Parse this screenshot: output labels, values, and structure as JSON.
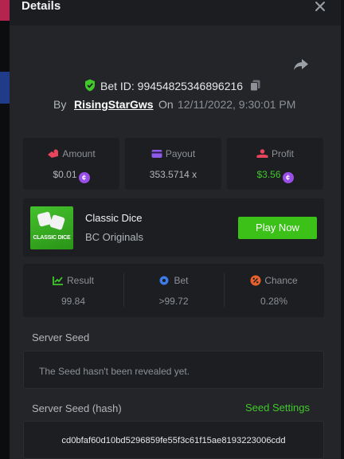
{
  "header": {
    "title": "Details"
  },
  "bet": {
    "id_text": "Bet ID: 99454825346896216",
    "by_label": "By",
    "user": "RisingStarGws",
    "on_label": "On",
    "datetime": "12/11/2022, 9:30:01 PM"
  },
  "stats": {
    "amount": {
      "label": "Amount",
      "value": "$0.01"
    },
    "payout": {
      "label": "Payout",
      "value": "353.5714 x"
    },
    "profit": {
      "label": "Profit",
      "value": "$3.56"
    }
  },
  "game": {
    "thumb_caption": "CLASSIC DICE",
    "name": "Classic Dice",
    "provider": "BC Originals",
    "play_label": "Play Now"
  },
  "result": {
    "result": {
      "label": "Result",
      "value": "99.84"
    },
    "bet": {
      "label": "Bet",
      "value": ">99.72"
    },
    "chance": {
      "label": "Chance",
      "value": "0.28%"
    }
  },
  "seeds": {
    "server_seed_label": "Server Seed",
    "server_seed_value": "The Seed hasn't been revealed yet.",
    "server_seed_hash_label": "Server Seed (hash)",
    "seed_settings_label": "Seed Settings",
    "server_seed_hash_value": "cd0bfaf60d10bd5296859fe55f3c61f15ae8193223006cdd"
  },
  "colors": {
    "accent_green": "#3bc117",
    "coin_purple": "#9a4ee8",
    "panel": "#1c1e21",
    "modal": "#232528"
  },
  "icons": [
    "close-icon",
    "share-icon",
    "shield-check-icon",
    "copy-icon",
    "amount-icon",
    "payout-icon",
    "profit-icon",
    "coin-icon",
    "result-icon",
    "bet-icon",
    "chance-icon"
  ]
}
